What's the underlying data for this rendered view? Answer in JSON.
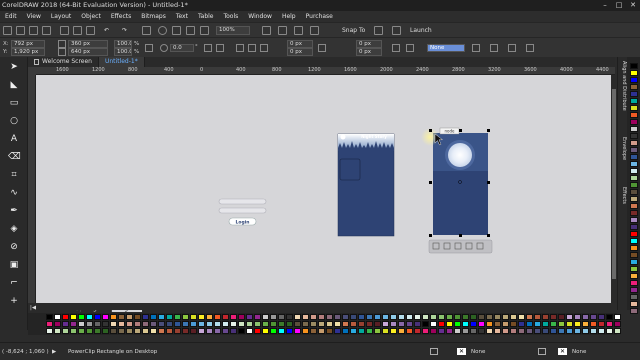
{
  "window": {
    "title": "CorelDRAW 2018 (64-Bit Evaluation Version) - Untitled-1*",
    "controls": [
      "–",
      "□",
      "✕"
    ]
  },
  "menu": [
    "Edit",
    "View",
    "Layout",
    "Object",
    "Effects",
    "Bitmaps",
    "Text",
    "Table",
    "Tools",
    "Window",
    "Help",
    "Purchase"
  ],
  "toolbar": {
    "zoom": "100%",
    "snap_to": "Snap To",
    "launch": "Launch"
  },
  "propbar": {
    "x_label": "X:",
    "x": "792 px",
    "y_label": "Y:",
    "y": "1,920 px",
    "width": "360 px",
    "height": "640 px",
    "scale_x": "100.0",
    "scale_y": "100.0",
    "percent": "%",
    "angle": "0.0",
    "angle_unit": "°",
    "corner_1": "0 px",
    "corner_2": "0 px",
    "corner_3": "0 px",
    "corner_4": "0 px",
    "outline": "None"
  },
  "tabs": {
    "welcome": "Welcome Screen",
    "document": "Untitled-1*"
  },
  "ruler_ticks": [
    "1600",
    "1200",
    "800",
    "400",
    "0",
    "400",
    "800",
    "1200",
    "1600",
    "2000",
    "2400",
    "2800",
    "3200",
    "3600",
    "4000",
    "4400",
    "4800"
  ],
  "canvas": {
    "login_button": "Login",
    "story_title": "Night Story",
    "tooltip": "node"
  },
  "pagebar": {
    "nav_prev": "|◀ ◀",
    "counter": "2  of  2",
    "nav_next": "▶ ▶|",
    "pages": [
      "Page 1",
      "Page 2"
    ]
  },
  "dockers": [
    "Align and Distribute",
    "Envelope",
    "Effects"
  ],
  "statusbar": {
    "coords": "( -8,624 ; 1,060 )",
    "arrow": "▶",
    "message": "PowerClip Rectangle on Desktop",
    "fill": "None",
    "outline": "None"
  },
  "colors": {
    "page_blue": "#2e4374",
    "canvas": "#d6d6d9",
    "accent": "#6ab0ff"
  },
  "icons": [
    "pick-tool-icon",
    "shape-tool-icon",
    "crop-tool-icon",
    "zoom-tool-icon",
    "freehand-tool-icon",
    "rectangle-tool-icon",
    "ellipse-tool-icon",
    "text-tool-icon",
    "moon-icon",
    "grass-silhouette-icon"
  ]
}
